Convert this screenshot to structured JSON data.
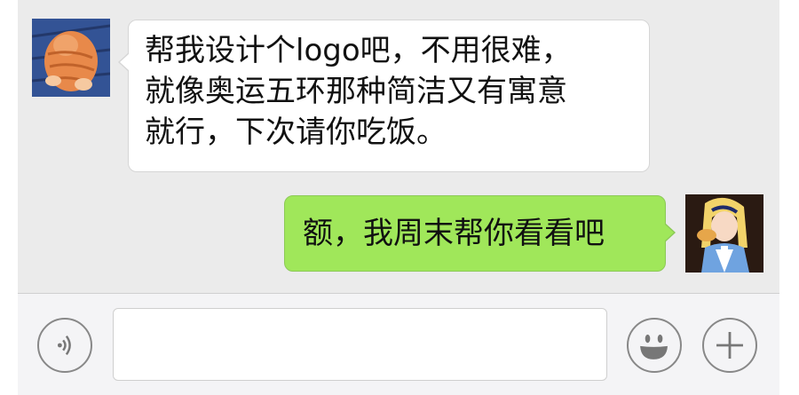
{
  "conversation": {
    "messages": [
      {
        "sender": "contact",
        "avatar_icon": "orange-cat-avatar",
        "lines": [
          "帮我设计个logo吧，不用很难，",
          "就像奥运五环那种简洁又有寓意",
          "就行，下次请你吃饭。"
        ]
      },
      {
        "sender": "me",
        "avatar_icon": "cartoon-girl-avatar",
        "text": "额，我周末帮你看看吧"
      }
    ]
  },
  "input_bar": {
    "voice_icon": "voice-icon",
    "message_value": "",
    "emoji_icon": "emoji-icon",
    "plus_icon": "plus-icon"
  },
  "colors": {
    "background": "#ebebeb",
    "incoming_bubble": "#ffffff",
    "outgoing_bubble": "#a0e75a",
    "input_bar": "#f4f4f6"
  }
}
